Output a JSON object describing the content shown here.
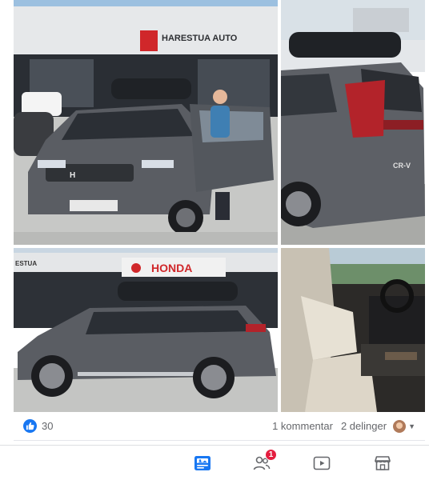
{
  "post": {
    "photos": [
      {
        "id": "photo-1",
        "sign_text": "HARESTUA AUTO"
      },
      {
        "id": "photo-2",
        "badge_text": "CR-V"
      },
      {
        "id": "photo-3",
        "sign_text": "HONDA",
        "side_sign_text": "ESTUA"
      },
      {
        "id": "photo-4"
      }
    ],
    "reactions": {
      "count": "30",
      "icon": "like-thumb-icon",
      "comments_label": "1 kommentar",
      "shares_label": "2 delinger"
    }
  },
  "tab_bar": {
    "items": [
      {
        "name": "feed",
        "icon": "news-feed-icon",
        "active": true
      },
      {
        "name": "friends",
        "icon": "friends-icon",
        "badge": "1"
      },
      {
        "name": "watch",
        "icon": "watch-video-icon"
      },
      {
        "name": "marketplace",
        "icon": "marketplace-icon"
      }
    ]
  },
  "colors": {
    "facebook_blue": "#1877f2",
    "badge_red": "#e41e3f",
    "car_gray": "#5a5d63",
    "honda_red": "#d0272a"
  }
}
